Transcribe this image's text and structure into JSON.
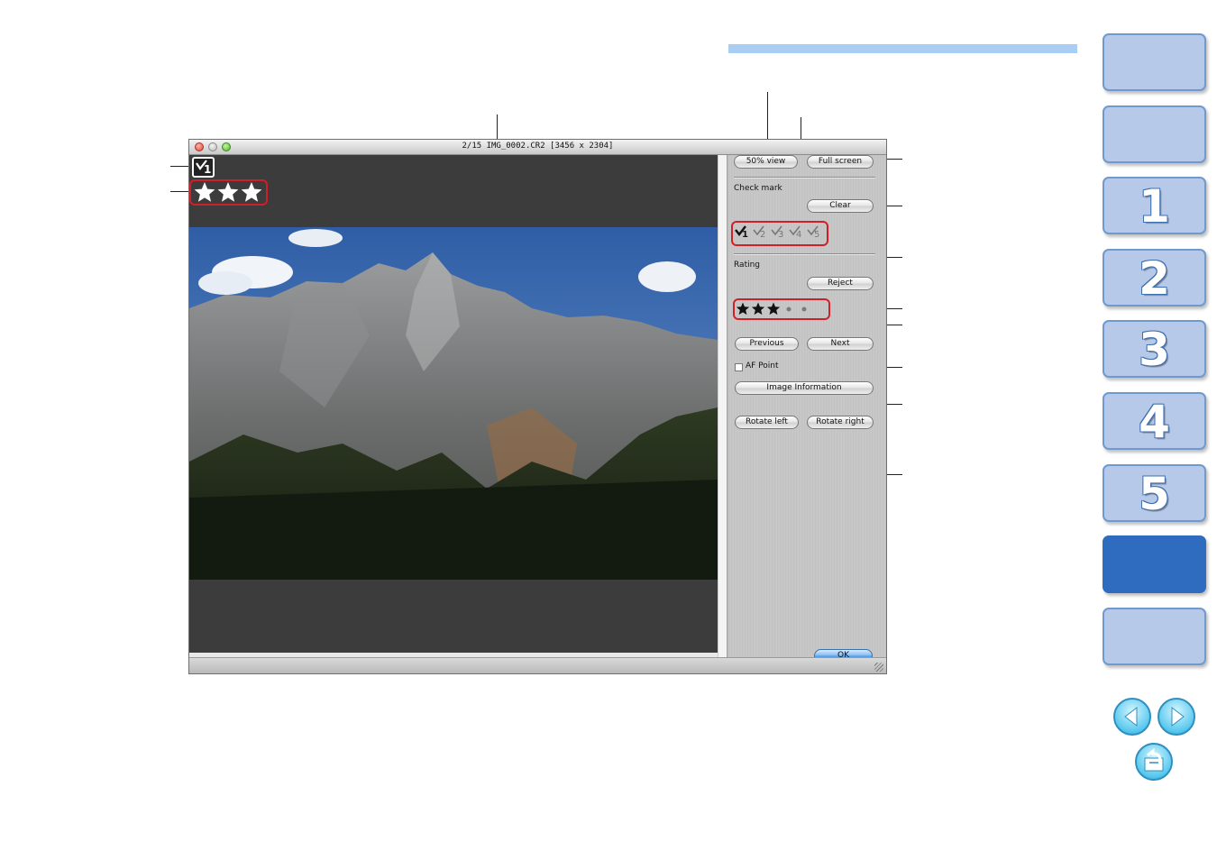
{
  "window": {
    "title": "2/15 IMG_0002.CR2 [3456 x 2304]"
  },
  "viewer": {
    "check_mark_number": "1",
    "rating_stars": 3,
    "rating_max": 5
  },
  "panel": {
    "view_button": "50% view",
    "fullscreen_button": "Full screen",
    "check_mark_label": "Check mark",
    "clear_button": "Clear",
    "check_marks": [
      "1",
      "2",
      "3",
      "4",
      "5"
    ],
    "selected_check_mark": "1",
    "rating_label": "Rating",
    "reject_button": "Reject",
    "previous_button": "Previous",
    "next_button": "Next",
    "af_point_label": "AF Point",
    "af_point_checked": false,
    "image_information_button": "Image Information",
    "rotate_left_button": "Rotate left",
    "rotate_right_button": "Rotate right",
    "ok_button": "OK"
  },
  "nav": {
    "tabs": [
      {
        "label": "",
        "active": false
      },
      {
        "label": "",
        "active": false
      },
      {
        "label": "1",
        "active": false
      },
      {
        "label": "2",
        "active": false
      },
      {
        "label": "3",
        "active": false
      },
      {
        "label": "4",
        "active": false
      },
      {
        "label": "5",
        "active": false
      },
      {
        "label": "",
        "active": true
      },
      {
        "label": "",
        "active": false
      }
    ],
    "prev_icon": "left-arrow-icon",
    "next_icon": "right-arrow-icon",
    "return_icon": "return-icon"
  },
  "colors": {
    "accent_blue": "#2f6cc0",
    "tab_blue": "#b7c9e8",
    "header_bar": "#a9cdf3",
    "highlight_red": "#d21f27"
  }
}
